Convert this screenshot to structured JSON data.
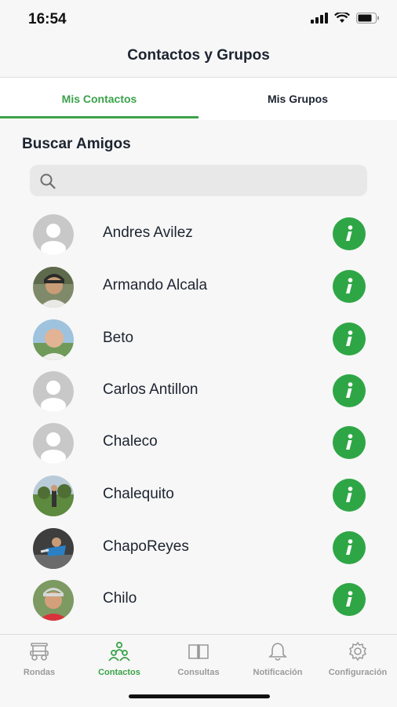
{
  "status": {
    "time": "16:54"
  },
  "nav": {
    "title": "Contactos y Grupos"
  },
  "tabs": [
    {
      "label": "Mis Contactos",
      "active": true
    },
    {
      "label": "Mis Grupos",
      "active": false
    }
  ],
  "search": {
    "section_title": "Buscar Amigos",
    "placeholder": "",
    "value": ""
  },
  "contacts": [
    {
      "name": "Andres Avilez",
      "avatar": "placeholder"
    },
    {
      "name": "Armando Alcala",
      "avatar": "photo"
    },
    {
      "name": "Beto",
      "avatar": "photo"
    },
    {
      "name": "Carlos Antillon",
      "avatar": "placeholder"
    },
    {
      "name": "Chaleco",
      "avatar": "placeholder"
    },
    {
      "name": "Chalequito",
      "avatar": "photo"
    },
    {
      "name": "ChapoReyes",
      "avatar": "photo"
    },
    {
      "name": "Chilo",
      "avatar": "photo"
    }
  ],
  "tabbar": [
    {
      "label": "Rondas",
      "icon": "golf-cart-icon",
      "active": false
    },
    {
      "label": "Contactos",
      "icon": "people-icon",
      "active": true
    },
    {
      "label": "Consultas",
      "icon": "book-icon",
      "active": false
    },
    {
      "label": "Notificación",
      "icon": "bell-icon",
      "active": false
    },
    {
      "label": "Configuración",
      "icon": "gear-icon",
      "active": false
    }
  ],
  "colors": {
    "accent": "#3aa24a",
    "info_button": "#2fa646",
    "background": "#f7f7f7"
  }
}
